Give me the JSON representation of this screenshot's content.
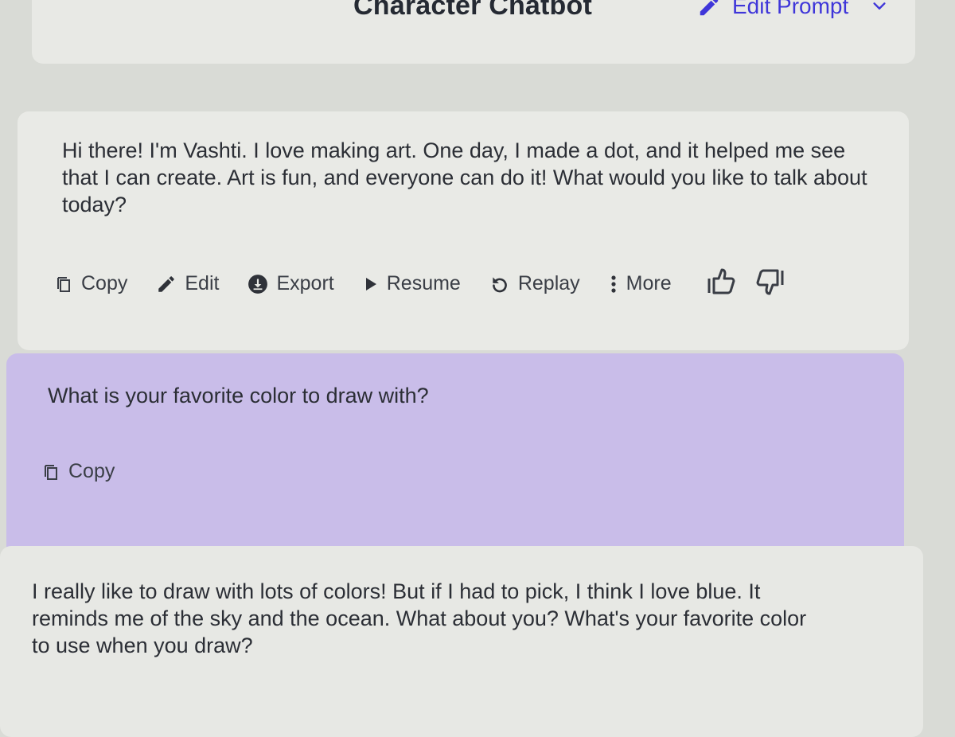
{
  "header": {
    "title": "Character Chatbot",
    "edit_prompt_label": "Edit Prompt"
  },
  "messages": [
    {
      "role": "bot",
      "text": "Hi there! I'm Vashti. I love making art. One day, I made a dot, and it helped me see that I can create. Art is fun, and everyone can do it! What would you like to talk about today?",
      "actions": {
        "copy": "Copy",
        "edit": "Edit",
        "export": "Export",
        "resume": "Resume",
        "replay": "Replay",
        "more": "More"
      }
    },
    {
      "role": "user",
      "text": "What is your favorite color to draw with?",
      "actions": {
        "copy": "Copy"
      }
    },
    {
      "role": "bot",
      "text": "I really like to draw with lots of colors! But if I had to pick, I think I love blue. It reminds me of the sky and the ocean. What about you? What's your favorite color to use when you draw?"
    }
  ],
  "colors": {
    "accent": "#3f36d9",
    "user_bubble": "#c9bde9",
    "bot_bubble": "#e9eae6",
    "background": "#d9dbd6"
  },
  "icons": {
    "edit_prompt": "pencil-icon",
    "dropdown": "chevron-down-icon",
    "copy": "copy-icon",
    "edit": "pencil-icon",
    "export": "download-circle-icon",
    "resume": "play-icon",
    "replay": "replay-icon",
    "more": "more-vertical-icon",
    "like": "thumbs-up-icon",
    "dislike": "thumbs-down-icon"
  }
}
